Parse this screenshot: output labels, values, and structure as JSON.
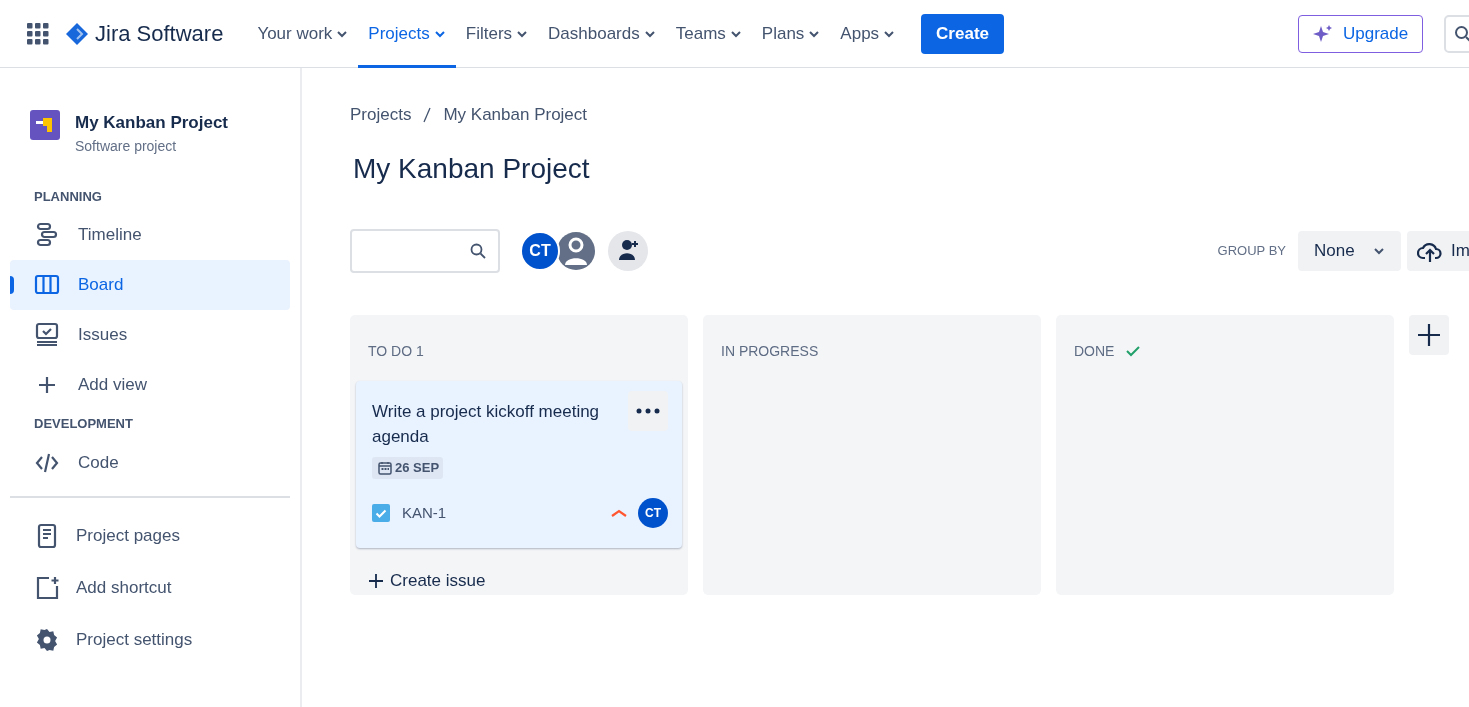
{
  "header": {
    "product": "Jira Software",
    "nav": [
      {
        "label": "Your work",
        "selected": false
      },
      {
        "label": "Projects",
        "selected": true
      },
      {
        "label": "Filters",
        "selected": false
      },
      {
        "label": "Dashboards",
        "selected": false
      },
      {
        "label": "Teams",
        "selected": false
      },
      {
        "label": "Plans",
        "selected": false
      },
      {
        "label": "Apps",
        "selected": false
      }
    ],
    "create": "Create",
    "upgrade": "Upgrade"
  },
  "sidebar": {
    "project": {
      "name": "My Kanban Project",
      "type": "Software project"
    },
    "sections": [
      {
        "heading": "PLANNING",
        "items": [
          {
            "label": "Timeline",
            "selected": false
          },
          {
            "label": "Board",
            "selected": true
          },
          {
            "label": "Issues",
            "selected": false
          },
          {
            "label": "Add view",
            "selected": false
          }
        ]
      },
      {
        "heading": "DEVELOPMENT",
        "items": [
          {
            "label": "Code",
            "selected": false
          }
        ]
      }
    ],
    "footer": [
      {
        "label": "Project pages"
      },
      {
        "label": "Add shortcut"
      },
      {
        "label": "Project settings"
      }
    ]
  },
  "breadcrumb": [
    "Projects",
    "My Kanban Project"
  ],
  "title": "My Kanban Project",
  "toolbar": {
    "avatars": [
      {
        "kind": "initials",
        "text": "CT"
      },
      {
        "kind": "silhouette"
      }
    ],
    "group_by_label": "GROUP BY",
    "group_by_value": "None",
    "import": "Im"
  },
  "columns": [
    {
      "title": "TO DO 1",
      "completed": false,
      "cards": [
        {
          "title": "Write a project kickoff meeting agenda",
          "due": "26 SEP",
          "key": "KAN-1",
          "assignee": "CT"
        }
      ],
      "create": "Create issue"
    },
    {
      "title": "IN PROGRESS",
      "completed": false
    },
    {
      "title": "DONE",
      "completed": true
    }
  ]
}
